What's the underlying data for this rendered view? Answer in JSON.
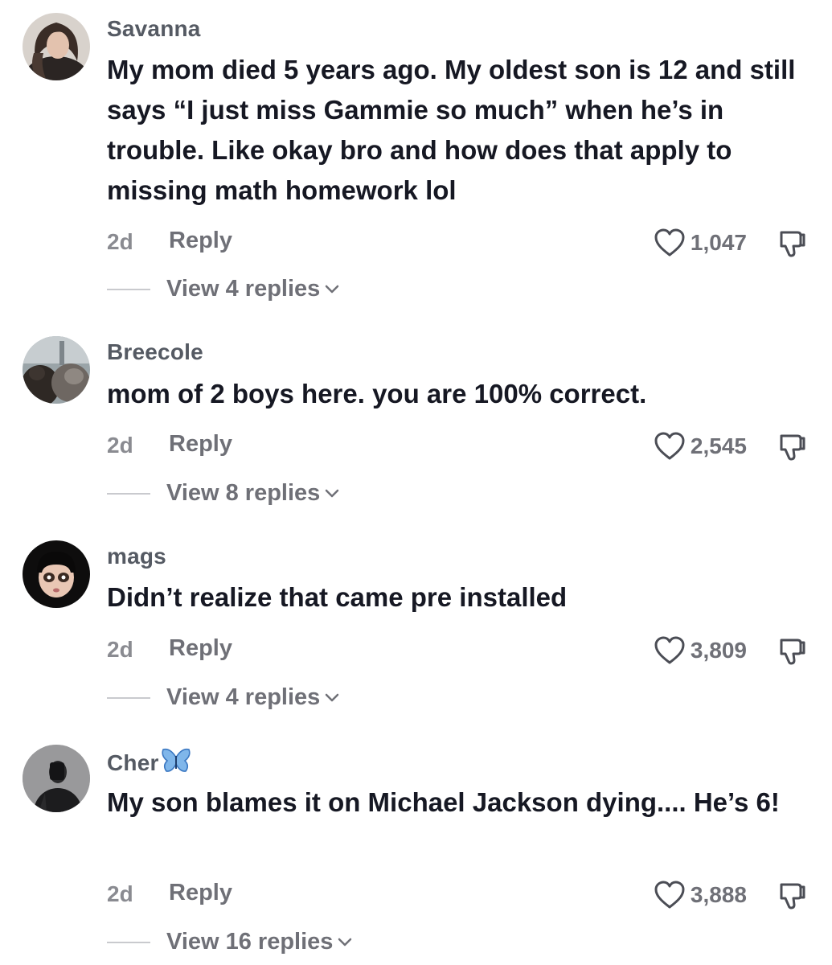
{
  "comments": [
    {
      "username": "Savanna",
      "text": "My mom died 5 years ago. My oldest son is 12 and still says “I just miss Gammie so much” when he’s in trouble. Like okay bro and how does that apply to missing math homework lol",
      "age": "2d",
      "reply_label": "Reply",
      "likes": "1,047",
      "view_replies": "View 4 replies",
      "avatar_icon": "avatar-photo-icon"
    },
    {
      "username": "Breecole",
      "text": "mom of 2 boys here. you are 100% correct.",
      "age": "2d",
      "reply_label": "Reply",
      "likes": "2,545",
      "view_replies": "View 8 replies",
      "avatar_icon": "avatar-photo-icon"
    },
    {
      "username": "mags",
      "text": "Didn’t realize that came pre installed",
      "age": "2d",
      "reply_label": "Reply",
      "likes": "3,809",
      "view_replies": "View 4 replies",
      "avatar_icon": "avatar-photo-icon"
    },
    {
      "username": "Cher",
      "username_emoji": "butterfly-icon",
      "text": "My son blames it on Michael Jackson dying.... He’s 6!",
      "age": "2d",
      "reply_label": "Reply",
      "likes": "3,888",
      "view_replies": "View 16 replies",
      "avatar_icon": "avatar-photo-icon"
    }
  ],
  "colors": {
    "text": "#161823",
    "username": "#555a63",
    "secondary": "#6f7077",
    "divider": "#c9cace"
  },
  "icons": {
    "like": "heart-icon",
    "dislike": "thumbs-down-icon",
    "expand": "chevron-down-icon"
  }
}
